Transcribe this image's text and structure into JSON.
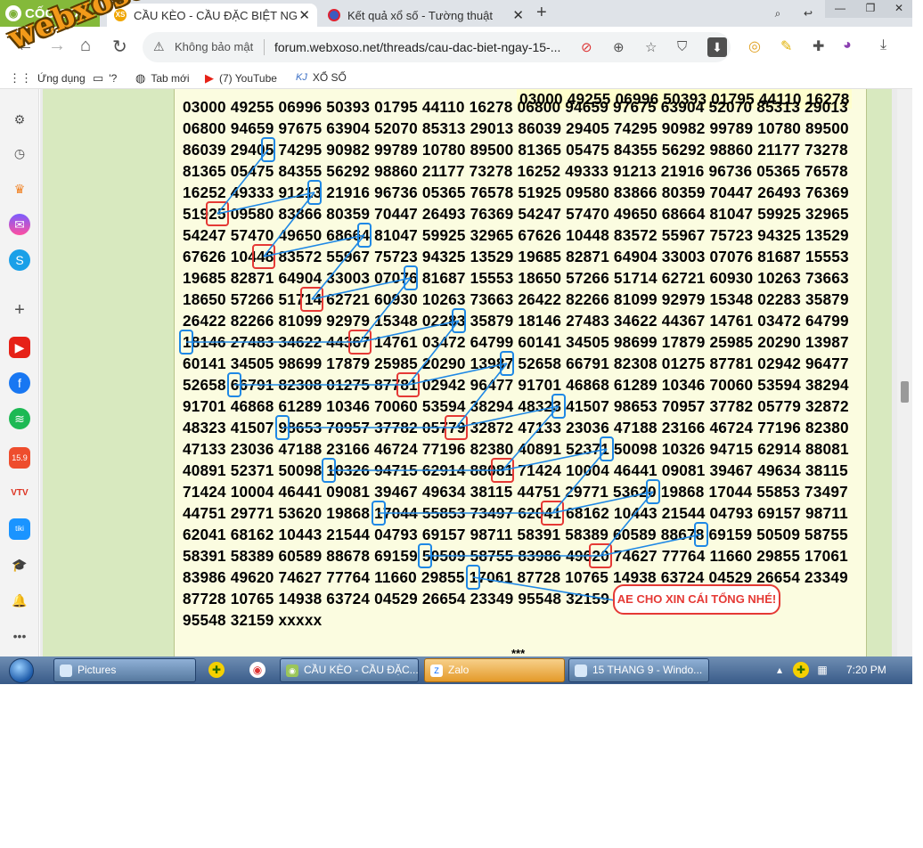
{
  "browser": {
    "brand": "CỐC CỐC",
    "tabs": [
      {
        "label": "CẦU KÈO - CẦU ĐẶC BIỆT NG",
        "favicon": "XS",
        "active": true
      },
      {
        "label": "Kết quả xổ số - Tường thuật",
        "favicon": "",
        "active": false
      }
    ],
    "new_tab": "+",
    "window_controls": [
      "minimize",
      "restore",
      "close"
    ],
    "security_label": "Không bảo mật",
    "url": "forum.webxoso.net/threads/cau-dac-biet-ngay-15-...",
    "bookmarks": [
      {
        "label": "Ứng dụng",
        "icon": "apps-grid-icon"
      },
      {
        "label": "'?",
        "icon": "folder-icon"
      },
      {
        "label": "Tab mới",
        "icon": "globe-icon"
      },
      {
        "label": "(7) YouTube",
        "icon": "youtube-icon"
      },
      {
        "label": "XỔ SỐ",
        "icon": "kj-icon"
      }
    ]
  },
  "watermark": "webxoso.net",
  "post": {
    "first_line": "03000 49255 06996 50393 01795 44110 16278",
    "lines": [
      "03000 49255 06996 50393 01795 44110 16278 06800 94659 97675 63904 52070 85313 29013",
      "06800 94659 97675 63904 52070 85313 29013 86039 29405 74295 90982 99789 10780 89500",
      "86039 29405 74295 90982 99789 10780 89500 81365 05475 84355 56292 98860 21177 73278",
      "81365 05475 84355 56292 98860 21177 73278 16252 49333 91213 21916 96736 05365 76578",
      "16252 49333 91213 21916 96736 05365 76578 51925 09580 83866 80359 70447 26493 76369",
      "51925 09580 83866 80359 70447 26493 76369 54247 57470 49650 68664 81047 59925 32965",
      "54247 57470 49650 68664 81047 59925 32965 67626 10448 83572 55967 75723 94325 13529",
      "67626 10448 83572 55967 75723 94325 13529 19685 82871 64904 33003 07076 81687 15553",
      "19685 82871 64904 33003 07076 81687 15553 18650 57266 51714 62721 60930 10263 73663",
      "18650 57266 51714 62721 60930 10263 73663 26422 82266 81099 92979 15348 02283 35879",
      "26422 82266 81099 92979 15348 02283 35879 18146 27483 34622 44367 14761 03472 64799",
      "18146 27483 34622 44367 14761 03472 64799 60141 34505 98699 17879 25985 20290 13987",
      "60141 34505 98699 17879 25985 20290 13987 52658 66791 82308 01275 87781 02942 96477",
      "52658 66791 82308 01275 87781 02942 96477 91701 46868 61289 10346 70060 53594 38294",
      "91701 46868 61289 10346 70060 53594 38294 48323 41507 98653 70957 37782 05779 32872",
      "48323 41507 98653 70957 37782 05779 32872 47133 23036 47188 23166 46724 77196 82380",
      "47133 23036 47188 23166 46724 77196 82380 40891 52371 50098 10326 94715 62914 88081",
      "40891 52371 50098 10326 94715 62914 88081 71424 10004 46441 09081 39467 49634 38115",
      "71424 10004 46441 09081 39467 49634 38115 44751 29771 53620 19868 17044 55853 73497",
      "44751 29771 53620 19868 17044 55853 73497 62041 68162 10443 21544 04793 69157 98711",
      "62041 68162 10443 21544 04793 69157 98711 58391 58389 60589 88678 69159 50509 58755",
      "58391 58389 60589 88678 69159 50509 58755 83986 49620 74627 77764 11660 29855 17061",
      "83986 49620 74627 77764 11660 29855 17061 87728 10765 14938 63724 04529 26654 23349",
      "87728 10765 14938 63724 04529 26654 23349 95548 32159",
      "95548 32159 xxxxx"
    ],
    "stars": "***",
    "callout": "AE CHO XIN CÁI TỔNG NHÉ!",
    "highlight_colors": {
      "blue": "#1e88e5",
      "red": "#e53935"
    }
  },
  "taskbar": {
    "items": [
      {
        "label": "Pictures",
        "active": false
      },
      {
        "label": "CẦU KÈO - CẦU ĐẶC...",
        "active": false
      },
      {
        "label": "Zalo",
        "active": true
      },
      {
        "label": "15 THANG 9 - Windo...",
        "active": false
      }
    ],
    "clock": "7:20 PM"
  }
}
